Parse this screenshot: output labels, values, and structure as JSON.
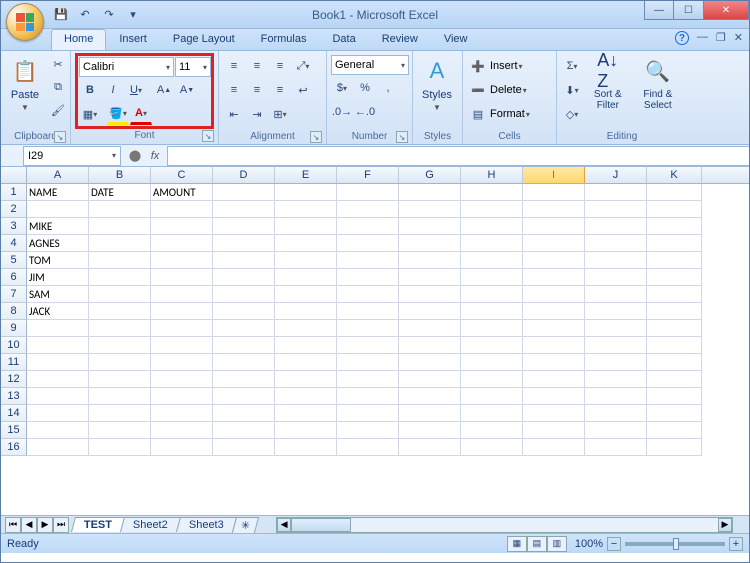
{
  "window": {
    "title": "Book1 - Microsoft Excel",
    "qat": {
      "save": "💾",
      "undo": "↶",
      "redo": "↷"
    }
  },
  "tabs": {
    "items": [
      "Home",
      "Insert",
      "Page Layout",
      "Formulas",
      "Data",
      "Review",
      "View"
    ],
    "active": "Home"
  },
  "ribbon": {
    "clipboard": {
      "label": "Clipboard",
      "paste": "Paste"
    },
    "font": {
      "label": "Font",
      "name": "Calibri",
      "size": "11"
    },
    "alignment": {
      "label": "Alignment"
    },
    "number": {
      "label": "Number",
      "format": "General"
    },
    "styles": {
      "label": "Styles",
      "btn": "Styles"
    },
    "cells": {
      "label": "Cells",
      "insert": "Insert",
      "delete": "Delete",
      "format": "Format"
    },
    "editing": {
      "label": "Editing",
      "sortfilter": "Sort & Filter",
      "findselect": "Find & Select"
    }
  },
  "formula_bar": {
    "name_box": "I29",
    "formula": ""
  },
  "grid": {
    "columns": [
      "A",
      "B",
      "C",
      "D",
      "E",
      "F",
      "G",
      "H",
      "I",
      "J",
      "K"
    ],
    "selected_column": "I",
    "row_count": 16,
    "data": {
      "1": {
        "A": "NAME",
        "B": "DATE",
        "C": "AMOUNT"
      },
      "3": {
        "A": "MIKE"
      },
      "4": {
        "A": "AGNES"
      },
      "5": {
        "A": "TOM"
      },
      "6": {
        "A": "JIM"
      },
      "7": {
        "A": "SAM"
      },
      "8": {
        "A": "JACK"
      }
    }
  },
  "sheets": {
    "tabs": [
      "TEST",
      "Sheet2",
      "Sheet3"
    ],
    "active": "TEST"
  },
  "statusbar": {
    "status": "Ready",
    "zoom": "100%"
  }
}
